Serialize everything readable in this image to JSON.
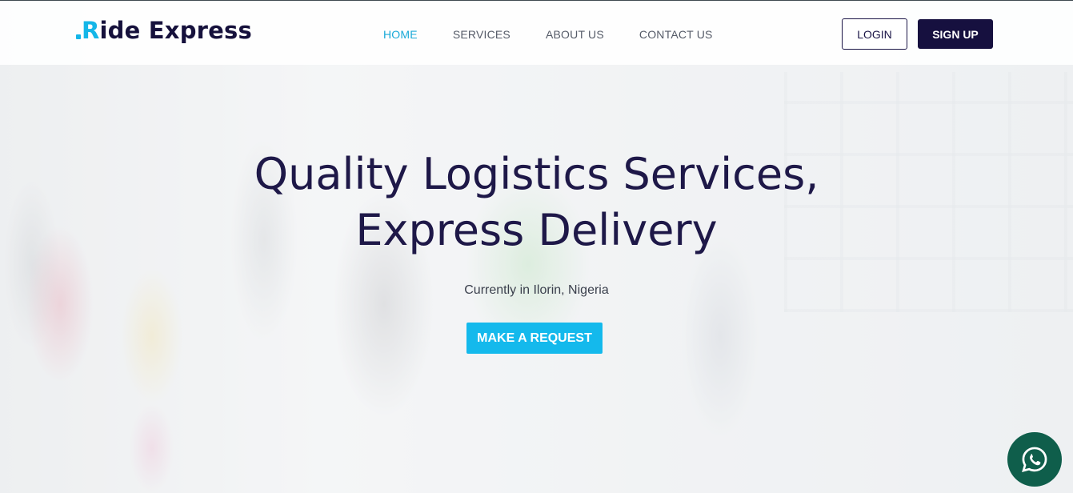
{
  "brand": {
    "name_rest": "ide Express",
    "name_first": "R"
  },
  "nav": {
    "items": [
      {
        "label": "HOME",
        "active": true
      },
      {
        "label": "SERVICES",
        "active": false
      },
      {
        "label": "ABOUT US",
        "active": false
      },
      {
        "label": "CONTACT US",
        "active": false
      }
    ]
  },
  "auth": {
    "login_label": "LOGIN",
    "signup_label": "SIGN UP"
  },
  "hero": {
    "title_line1": "Quality Logistics Services,",
    "title_line2": "Express Delivery",
    "subtitle": "Currently in Ilorin, Nigeria",
    "cta_label": "MAKE A REQUEST"
  },
  "whatsapp": {
    "icon": "whatsapp-icon"
  },
  "colors": {
    "accent": "#14b9ec",
    "brand_dark": "#16103f",
    "whatsapp_bg": "#0f5e4b"
  }
}
